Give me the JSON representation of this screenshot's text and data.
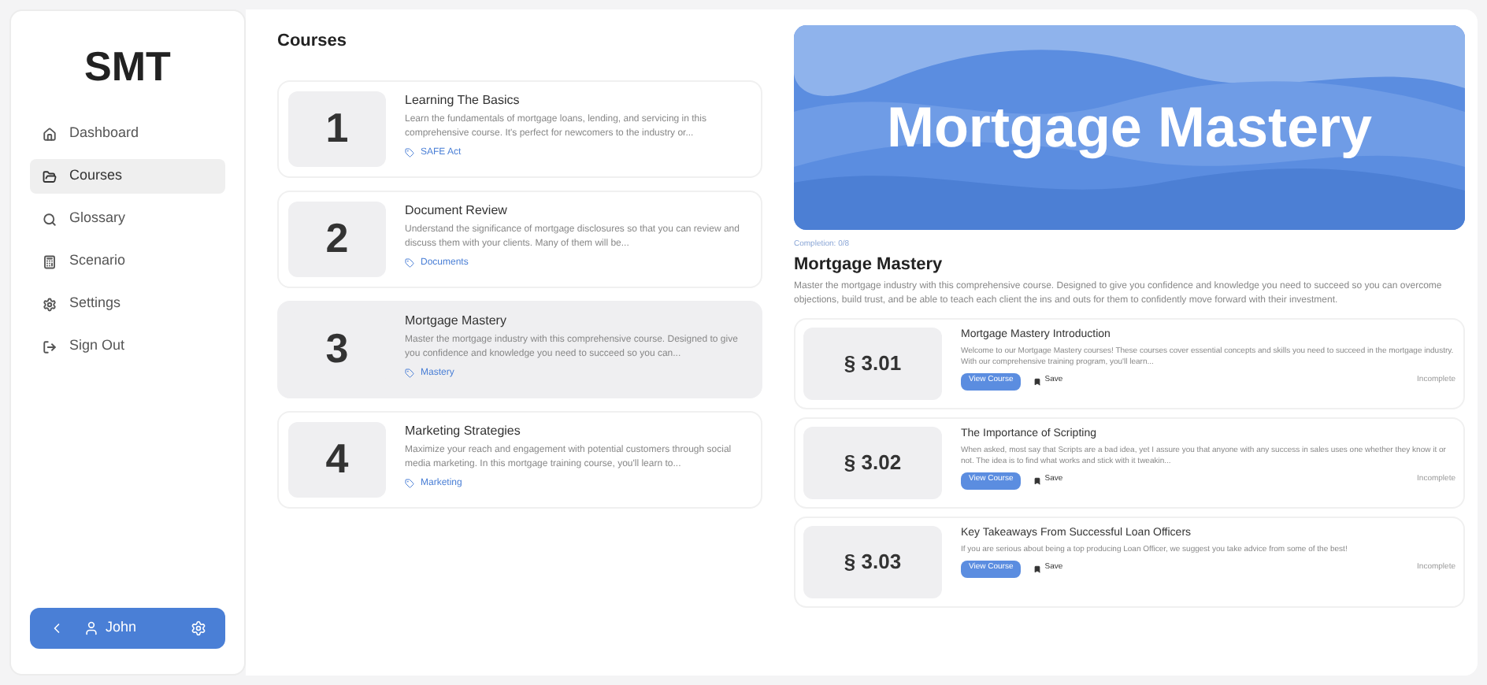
{
  "sidebar": {
    "logo": "SMT",
    "items": [
      {
        "label": "Dashboard",
        "selected": false
      },
      {
        "label": "Courses",
        "selected": true
      },
      {
        "label": "Glossary",
        "selected": false
      },
      {
        "label": "Scenario",
        "selected": false
      },
      {
        "label": "Settings",
        "selected": false
      },
      {
        "label": "Sign Out",
        "selected": false
      }
    ],
    "user": {
      "name": "John"
    }
  },
  "courses": {
    "title": "Courses",
    "items": [
      {
        "number": "1",
        "title": "Learning The Basics",
        "description": "Learn the fundamentals of mortgage loans, lending, and servicing in this comprehensive course. It's perfect for newcomers to the industry or...",
        "tag": "SAFE Act",
        "selected": false
      },
      {
        "number": "2",
        "title": "Document Review",
        "description": "Understand the significance of mortgage disclosures so that you can review and discuss them with your clients. Many of them will be...",
        "tag": "Documents",
        "selected": false
      },
      {
        "number": "3",
        "title": "Mortgage Mastery",
        "description": "Master the mortgage industry with this comprehensive course. Designed to give you confidence and knowledge you need to succeed so you can...",
        "tag": "Mastery",
        "selected": true
      },
      {
        "number": "4",
        "title": "Marketing Strategies",
        "description": "Maximize your reach and engagement with potential customers through social media marketing. In this mortgage training course, you'll learn to...",
        "tag": "Marketing",
        "selected": false
      }
    ]
  },
  "detail": {
    "banner": "Mortgage Mastery",
    "completion": "Completion: 0/8",
    "title": "Mortgage Mastery",
    "description": "Master the mortgage industry with this comprehensive course. Designed to give you confidence and knowledge you need to succeed so you can overcome objections, build trust, and be able to teach each client the ins and outs for them to confidently move forward with their investment.",
    "lessons": [
      {
        "number": "§ 3.01",
        "title": "Mortgage Mastery Introduction",
        "description": "Welcome to our Mortgage Mastery courses! These courses cover essential concepts and skills you need to succeed in the mortgage industry. With our comprehensive training program, you'll learn...",
        "button": "View Course",
        "save": "Save",
        "status": "Incomplete"
      },
      {
        "number": "§ 3.02",
        "title": "The Importance of Scripting",
        "description": "When asked, most say that Scripts are a bad idea, yet I assure you that anyone with any success in sales uses one whether they know it or not. The idea is to find what works and stick with it tweakin...",
        "button": "View Course",
        "save": "Save",
        "status": "Incomplete"
      },
      {
        "number": "§ 3.03",
        "title": "Key Takeaways From Successful Loan Officers",
        "description": "If you are serious about being a top producing Loan Officer, we suggest you take advice from some of the best!",
        "button": "View Course",
        "save": "Save",
        "status": "Incomplete"
      }
    ]
  }
}
